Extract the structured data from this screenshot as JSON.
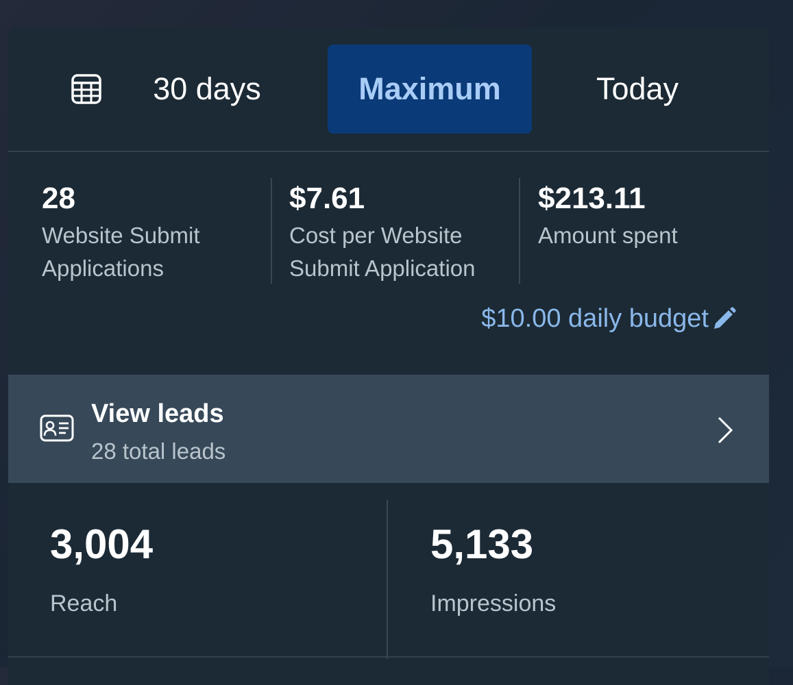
{
  "date_range": {
    "options": [
      "30 days",
      "Maximum",
      "Today"
    ],
    "selected": "Maximum"
  },
  "stats": [
    {
      "value": "28",
      "label_line1": "Website Submit",
      "label_line2": "Applications"
    },
    {
      "value": "$7.61",
      "label_line1": "Cost per Website",
      "label_line2": "Submit Application"
    },
    {
      "value": "$213.11",
      "label_line1": "Amount spent",
      "label_line2": ""
    }
  ],
  "budget": {
    "text": "$10.00 daily budget",
    "icon": "pencil-icon"
  },
  "leads": {
    "title": "View leads",
    "subtitle": "28 total leads",
    "icon": "id-card-icon"
  },
  "metrics": [
    {
      "value": "3,004",
      "label": "Reach"
    },
    {
      "value": "5,133",
      "label": "Impressions"
    }
  ],
  "colors": {
    "card_bg": "#1c2a35",
    "selected_bg": "#0b3a78",
    "selected_text": "#a9cdf7",
    "link": "#8ab8ea",
    "leads_row_bg": "#374959"
  }
}
